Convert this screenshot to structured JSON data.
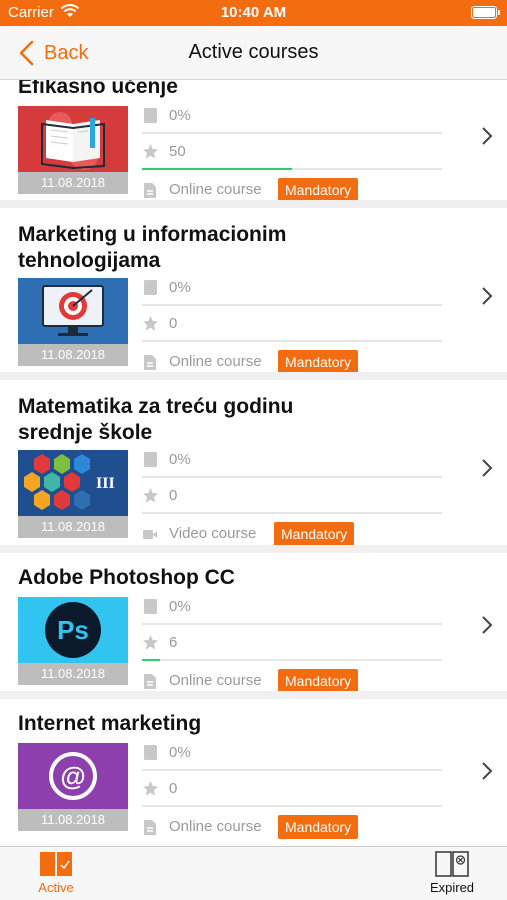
{
  "status_bar": {
    "carrier": "Carrier",
    "time": "10:40 AM"
  },
  "nav": {
    "back_label": "Back",
    "title": "Active courses"
  },
  "colors": {
    "accent": "#f36c0f",
    "progress": "#2ecc71",
    "muted": "#9a9a9a"
  },
  "courses": [
    {
      "title": "Efikasno učenje",
      "date": "11.08.2018",
      "progress": "0%",
      "rating": "50",
      "rating_fill": 0.5,
      "type": "Online course",
      "type_icon": "document-icon",
      "badge": "Mandatory",
      "thumb": "book-icon"
    },
    {
      "title": "Marketing u informacionim tehnologijama",
      "date": "11.08.2018",
      "progress": "0%",
      "rating": "0",
      "rating_fill": 0,
      "type": "Online course",
      "type_icon": "document-icon",
      "badge": "Mandatory",
      "thumb": "target-monitor-icon"
    },
    {
      "title": "Matematika za treću godinu srednje škole",
      "date": "11.08.2018",
      "progress": "0%",
      "rating": "0",
      "rating_fill": 0,
      "type": "Video course",
      "type_icon": "video-camera-icon",
      "badge": "Mandatory",
      "thumb": "math-hexagons-icon",
      "thumb_text": "III"
    },
    {
      "title": "Adobe Photoshop CC",
      "date": "11.08.2018",
      "progress": "0%",
      "rating": "6",
      "rating_fill": 0.06,
      "type": "Online course",
      "type_icon": "document-icon",
      "badge": "Mandatory",
      "thumb": "photoshop-icon",
      "thumb_text": "Ps"
    },
    {
      "title": "Internet marketing",
      "date": "11.08.2018",
      "progress": "0%",
      "rating": "0",
      "rating_fill": 0,
      "type": "Online course",
      "type_icon": "document-icon",
      "badge": "Mandatory",
      "thumb": "at-sign-icon",
      "thumb_text": "@"
    }
  ],
  "tabs": [
    {
      "label": "Active",
      "icon": "active-courses-icon",
      "selected": true
    },
    {
      "label": "Expired",
      "icon": "expired-courses-icon",
      "selected": false
    }
  ]
}
